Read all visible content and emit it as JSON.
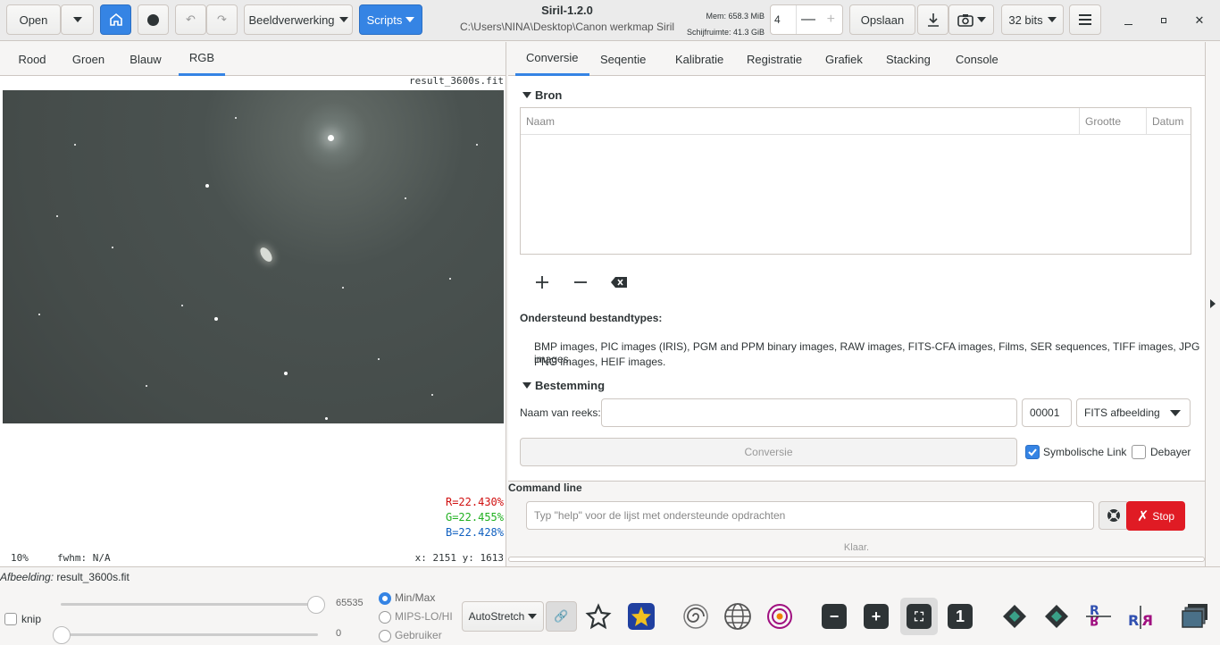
{
  "header": {
    "open": "Open",
    "processing": "Beeldverwerking",
    "scripts": "Scripts",
    "title": "Siril-1.2.0",
    "path": "C:\\Users\\NINA\\Desktop\\Canon werkmap Siril",
    "mem": "Mem: 658.3 MiB",
    "disk": "Schijfruimte: 41.3 GiB",
    "threads": "4",
    "save": "Opslaan",
    "bits": "32 bits"
  },
  "left": {
    "tabs": [
      "Rood",
      "Groen",
      "Blauw",
      "RGB"
    ],
    "active_tab": "RGB",
    "filename": "result_3600s.fit",
    "r": "R=22.430%",
    "g": "G=22.455%",
    "b": "B=22.428%",
    "zoom": "10%",
    "fwhm": "fwhm: N/A",
    "coords": "x: 2151 y: 1613"
  },
  "right": {
    "tabs": [
      "Conversie",
      "Seqentie",
      "Kalibratie",
      "Registratie",
      "Grafiek",
      "Stacking",
      "Console"
    ],
    "source_title": "Bron",
    "cols": [
      "Naam",
      "Grootte",
      "Datum"
    ],
    "supported_title": "Ondersteund bestandtypes:",
    "supported_text_1": "BMP images, PIC images (IRIS), PGM and PPM binary images, RAW images, FITS-CFA images, Films, SER sequences, TIFF images, JPG images,",
    "supported_text_2": "PNG images, HEIF images.",
    "dest_title": "Bestemming",
    "seq_name_label": "Naam van reeks:",
    "seq_num": "00001",
    "format": "FITS afbeelding",
    "convert": "Conversie",
    "symlink": "Symbolische Link",
    "debayer": "Debayer",
    "cmd_label": "Command line",
    "cmd_placeholder": "Typ \"help\" voor de lijst met ondersteunde opdrachten",
    "stop": "Stop",
    "status": "Klaar."
  },
  "bottom": {
    "image_label": "Afbeelding:",
    "image_name": "result_3600s.fit",
    "knip": "knip",
    "max_val": "65535",
    "min_val": "0",
    "minmax": "Min/Max",
    "mips": "MIPS-LO/HI",
    "user": "Gebruiker",
    "stretch": "AutoStretch",
    "one": "1"
  }
}
